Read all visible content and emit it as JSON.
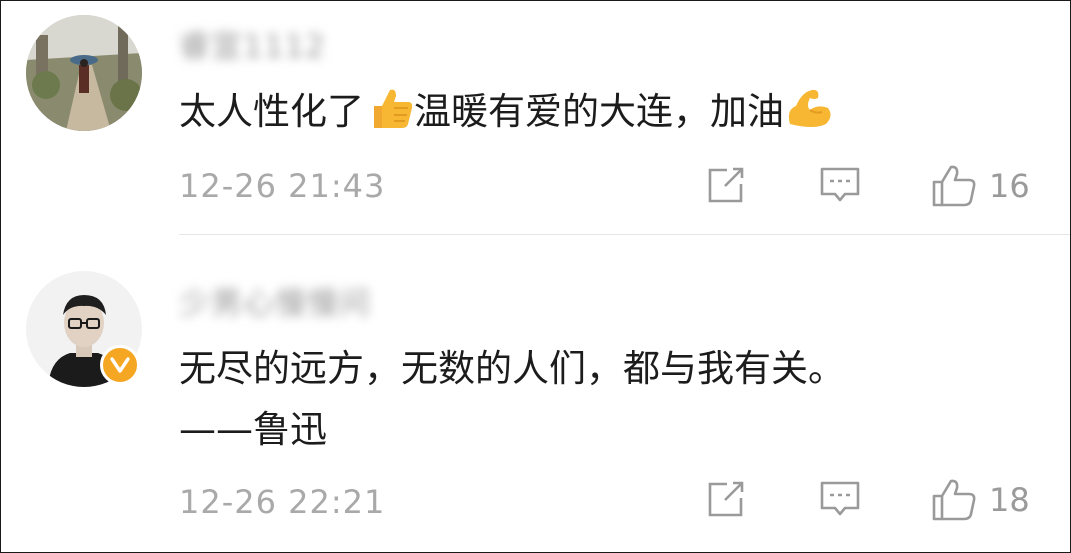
{
  "comments": [
    {
      "username": "睿宣1112",
      "text_before": "太人性化了",
      "emoji1": "thumbs-up",
      "text_middle": "温暖有爱的大连，加油",
      "emoji2": "flexed-biceps",
      "time": "12-26 21:43",
      "likes": "16"
    },
    {
      "username": "少男心慢慢问",
      "verified": true,
      "text": "无尽的远方，无数的人们，都与我有关。\n——鲁迅",
      "time": "12-26 22:21",
      "likes": "18"
    }
  ],
  "icons": {
    "share": "share-icon",
    "reply": "comment-icon",
    "like": "like-icon",
    "verified": "verified-badge-icon"
  },
  "colors": {
    "text": "#1c1c1c",
    "meta": "#a9a9a9",
    "icon": "#9a9a9a",
    "verified": "#f5a623",
    "emoji": "#f7b733"
  }
}
